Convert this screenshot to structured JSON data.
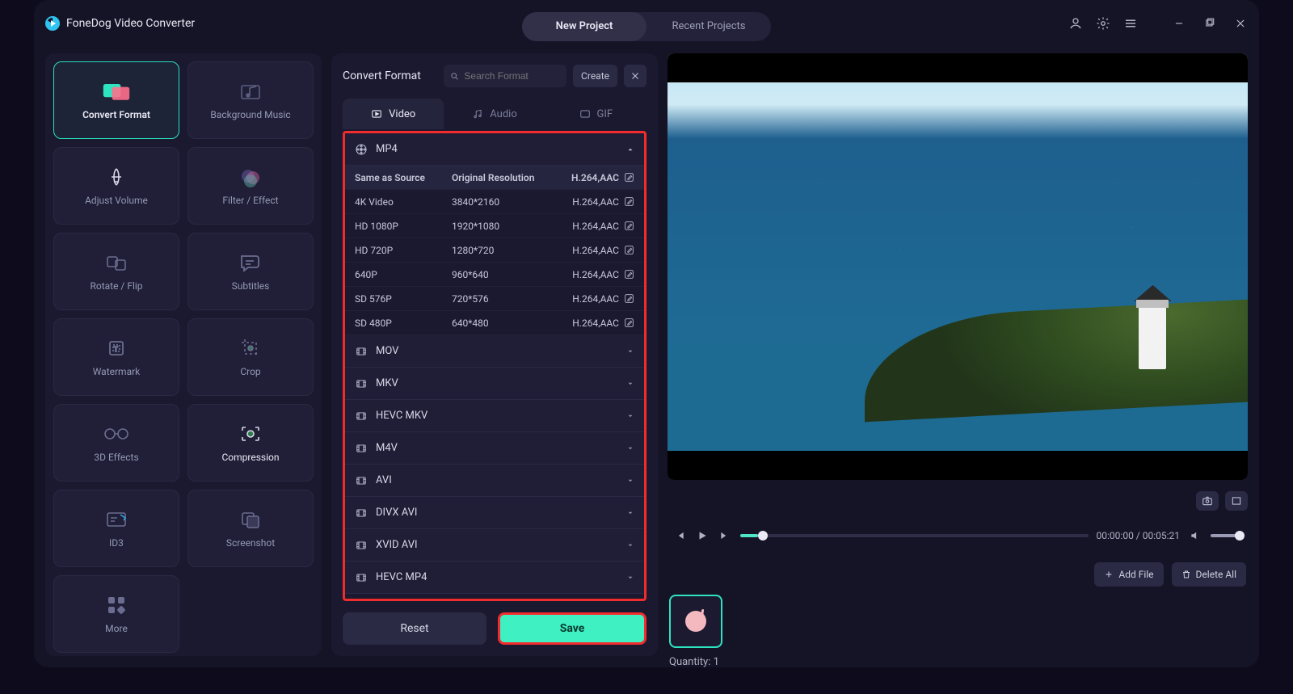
{
  "app_name": "FoneDog Video Converter",
  "top_tabs": {
    "new_project": "New Project",
    "recent_projects": "Recent Projects"
  },
  "sidebar": {
    "items": [
      {
        "id": "convert-format",
        "label": "Convert Format",
        "selected": true
      },
      {
        "id": "background-music",
        "label": "Background Music"
      },
      {
        "id": "adjust-volume",
        "label": "Adjust Volume"
      },
      {
        "id": "filter-effect",
        "label": "Filter / Effect"
      },
      {
        "id": "rotate-flip",
        "label": "Rotate / Flip"
      },
      {
        "id": "subtitles",
        "label": "Subtitles"
      },
      {
        "id": "watermark",
        "label": "Watermark"
      },
      {
        "id": "crop",
        "label": "Crop"
      },
      {
        "id": "3d-effects",
        "label": "3D Effects"
      },
      {
        "id": "compression",
        "label": "Compression",
        "highlight": true
      },
      {
        "id": "id3",
        "label": "ID3"
      },
      {
        "id": "screenshot",
        "label": "Screenshot"
      },
      {
        "id": "more",
        "label": "More"
      }
    ]
  },
  "panel": {
    "title": "Convert Format",
    "search_placeholder": "Search Format",
    "create": "Create",
    "tabs": {
      "video": "Video",
      "audio": "Audio",
      "gif": "GIF"
    },
    "groups": [
      {
        "name": "MP4",
        "expanded": true,
        "rows": [
          {
            "name": "Same as Source",
            "res": "Original Resolution",
            "codec": "H.264,AAC",
            "header": true
          },
          {
            "name": "4K Video",
            "res": "3840*2160",
            "codec": "H.264,AAC"
          },
          {
            "name": "HD 1080P",
            "res": "1920*1080",
            "codec": "H.264,AAC"
          },
          {
            "name": "HD 720P",
            "res": "1280*720",
            "codec": "H.264,AAC"
          },
          {
            "name": "640P",
            "res": "960*640",
            "codec": "H.264,AAC"
          },
          {
            "name": "SD 576P",
            "res": "720*576",
            "codec": "H.264,AAC"
          },
          {
            "name": "SD 480P",
            "res": "640*480",
            "codec": "H.264,AAC"
          }
        ]
      },
      {
        "name": "MOV"
      },
      {
        "name": "MKV"
      },
      {
        "name": "HEVC MKV"
      },
      {
        "name": "M4V"
      },
      {
        "name": "AVI"
      },
      {
        "name": "DIVX AVI"
      },
      {
        "name": "XVID AVI"
      },
      {
        "name": "HEVC MP4"
      }
    ],
    "reset": "Reset",
    "save": "Save"
  },
  "player": {
    "elapsed": "00:00:00",
    "duration": "00:05:21"
  },
  "queue": {
    "add_file": "Add File",
    "delete_all": "Delete All",
    "quantity_label": "Quantity:",
    "quantity": "1"
  }
}
